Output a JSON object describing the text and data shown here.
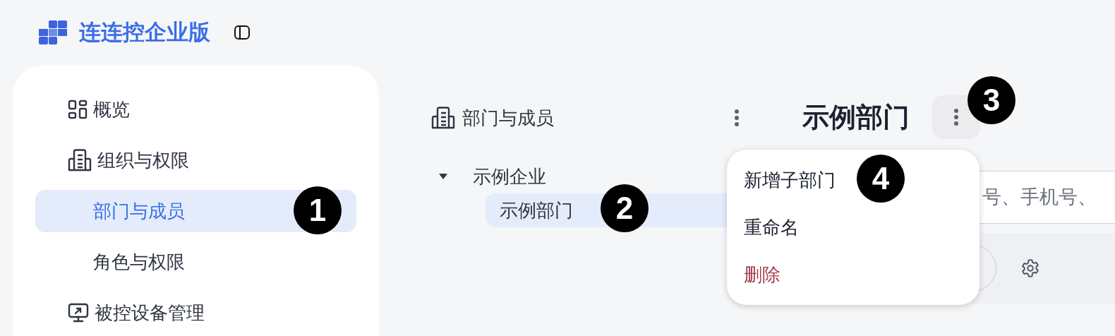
{
  "app": {
    "title": "连连控企业版"
  },
  "sidebar": {
    "items": [
      {
        "label": "概览",
        "selected": false
      },
      {
        "label": "组织与权限",
        "selected": false,
        "children": [
          {
            "label": "部门与成员",
            "selected": true
          },
          {
            "label": "角色与权限",
            "selected": false
          }
        ]
      },
      {
        "label": "被控设备管理",
        "selected": false
      }
    ]
  },
  "tree_panel": {
    "title": "部门与成员",
    "nodes": [
      {
        "label": "示例企业",
        "expanded": true,
        "selected": false,
        "children": [
          {
            "label": "示例部门",
            "selected": true
          }
        ]
      }
    ]
  },
  "detail": {
    "title": "示例部门",
    "search": {
      "placeholder": "号、手机号、"
    }
  },
  "menu": {
    "items": [
      {
        "label": "新增子部门",
        "kind": "normal"
      },
      {
        "label": "重命名",
        "kind": "normal"
      },
      {
        "label": "删除",
        "kind": "danger"
      }
    ]
  },
  "annotations": [
    {
      "label": "1"
    },
    {
      "label": "2"
    },
    {
      "label": "3"
    },
    {
      "label": "4"
    }
  ]
}
